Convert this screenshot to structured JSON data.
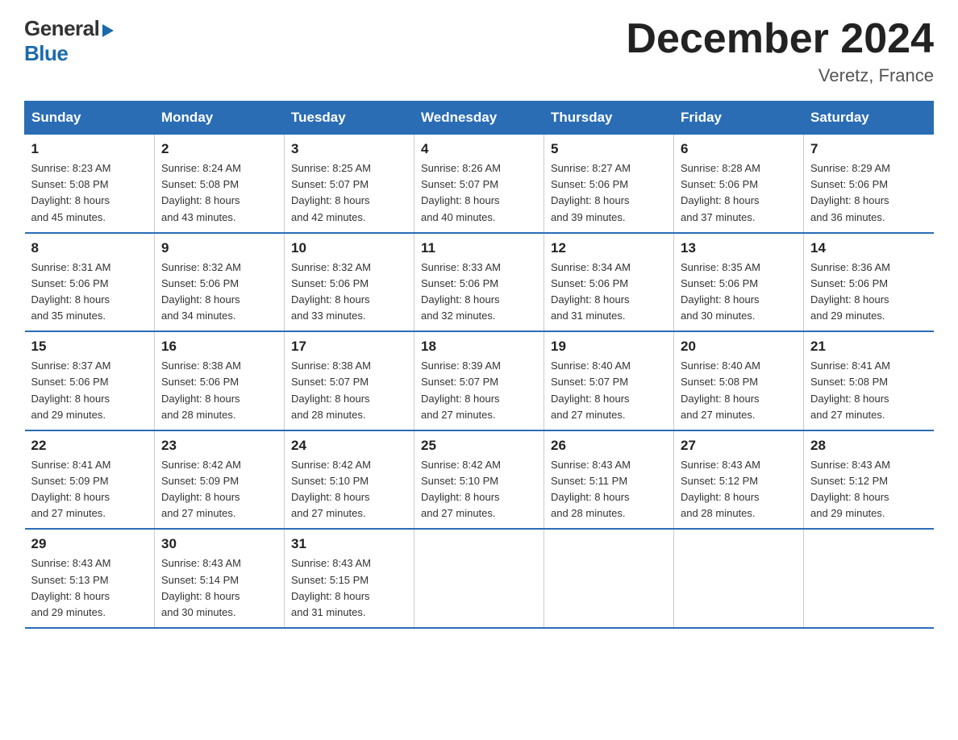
{
  "header": {
    "logo_general": "General",
    "logo_blue": "Blue",
    "title": "December 2024",
    "location": "Veretz, France"
  },
  "days_of_week": [
    "Sunday",
    "Monday",
    "Tuesday",
    "Wednesday",
    "Thursday",
    "Friday",
    "Saturday"
  ],
  "weeks": [
    [
      {
        "num": "1",
        "sunrise": "8:23 AM",
        "sunset": "5:08 PM",
        "daylight": "8 hours and 45 minutes."
      },
      {
        "num": "2",
        "sunrise": "8:24 AM",
        "sunset": "5:08 PM",
        "daylight": "8 hours and 43 minutes."
      },
      {
        "num": "3",
        "sunrise": "8:25 AM",
        "sunset": "5:07 PM",
        "daylight": "8 hours and 42 minutes."
      },
      {
        "num": "4",
        "sunrise": "8:26 AM",
        "sunset": "5:07 PM",
        "daylight": "8 hours and 40 minutes."
      },
      {
        "num": "5",
        "sunrise": "8:27 AM",
        "sunset": "5:06 PM",
        "daylight": "8 hours and 39 minutes."
      },
      {
        "num": "6",
        "sunrise": "8:28 AM",
        "sunset": "5:06 PM",
        "daylight": "8 hours and 37 minutes."
      },
      {
        "num": "7",
        "sunrise": "8:29 AM",
        "sunset": "5:06 PM",
        "daylight": "8 hours and 36 minutes."
      }
    ],
    [
      {
        "num": "8",
        "sunrise": "8:31 AM",
        "sunset": "5:06 PM",
        "daylight": "8 hours and 35 minutes."
      },
      {
        "num": "9",
        "sunrise": "8:32 AM",
        "sunset": "5:06 PM",
        "daylight": "8 hours and 34 minutes."
      },
      {
        "num": "10",
        "sunrise": "8:32 AM",
        "sunset": "5:06 PM",
        "daylight": "8 hours and 33 minutes."
      },
      {
        "num": "11",
        "sunrise": "8:33 AM",
        "sunset": "5:06 PM",
        "daylight": "8 hours and 32 minutes."
      },
      {
        "num": "12",
        "sunrise": "8:34 AM",
        "sunset": "5:06 PM",
        "daylight": "8 hours and 31 minutes."
      },
      {
        "num": "13",
        "sunrise": "8:35 AM",
        "sunset": "5:06 PM",
        "daylight": "8 hours and 30 minutes."
      },
      {
        "num": "14",
        "sunrise": "8:36 AM",
        "sunset": "5:06 PM",
        "daylight": "8 hours and 29 minutes."
      }
    ],
    [
      {
        "num": "15",
        "sunrise": "8:37 AM",
        "sunset": "5:06 PM",
        "daylight": "8 hours and 29 minutes."
      },
      {
        "num": "16",
        "sunrise": "8:38 AM",
        "sunset": "5:06 PM",
        "daylight": "8 hours and 28 minutes."
      },
      {
        "num": "17",
        "sunrise": "8:38 AM",
        "sunset": "5:07 PM",
        "daylight": "8 hours and 28 minutes."
      },
      {
        "num": "18",
        "sunrise": "8:39 AM",
        "sunset": "5:07 PM",
        "daylight": "8 hours and 27 minutes."
      },
      {
        "num": "19",
        "sunrise": "8:40 AM",
        "sunset": "5:07 PM",
        "daylight": "8 hours and 27 minutes."
      },
      {
        "num": "20",
        "sunrise": "8:40 AM",
        "sunset": "5:08 PM",
        "daylight": "8 hours and 27 minutes."
      },
      {
        "num": "21",
        "sunrise": "8:41 AM",
        "sunset": "5:08 PM",
        "daylight": "8 hours and 27 minutes."
      }
    ],
    [
      {
        "num": "22",
        "sunrise": "8:41 AM",
        "sunset": "5:09 PM",
        "daylight": "8 hours and 27 minutes."
      },
      {
        "num": "23",
        "sunrise": "8:42 AM",
        "sunset": "5:09 PM",
        "daylight": "8 hours and 27 minutes."
      },
      {
        "num": "24",
        "sunrise": "8:42 AM",
        "sunset": "5:10 PM",
        "daylight": "8 hours and 27 minutes."
      },
      {
        "num": "25",
        "sunrise": "8:42 AM",
        "sunset": "5:10 PM",
        "daylight": "8 hours and 27 minutes."
      },
      {
        "num": "26",
        "sunrise": "8:43 AM",
        "sunset": "5:11 PM",
        "daylight": "8 hours and 28 minutes."
      },
      {
        "num": "27",
        "sunrise": "8:43 AM",
        "sunset": "5:12 PM",
        "daylight": "8 hours and 28 minutes."
      },
      {
        "num": "28",
        "sunrise": "8:43 AM",
        "sunset": "5:12 PM",
        "daylight": "8 hours and 29 minutes."
      }
    ],
    [
      {
        "num": "29",
        "sunrise": "8:43 AM",
        "sunset": "5:13 PM",
        "daylight": "8 hours and 29 minutes."
      },
      {
        "num": "30",
        "sunrise": "8:43 AM",
        "sunset": "5:14 PM",
        "daylight": "8 hours and 30 minutes."
      },
      {
        "num": "31",
        "sunrise": "8:43 AM",
        "sunset": "5:15 PM",
        "daylight": "8 hours and 31 minutes."
      },
      null,
      null,
      null,
      null
    ]
  ],
  "labels": {
    "sunrise": "Sunrise:",
    "sunset": "Sunset:",
    "daylight": "Daylight:"
  }
}
